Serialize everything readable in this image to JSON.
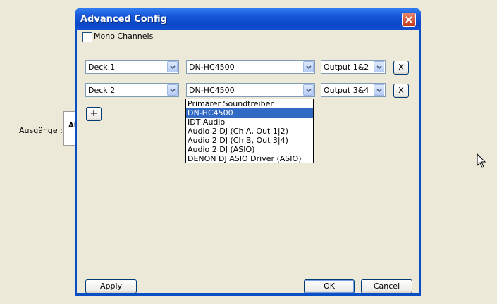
{
  "background": {
    "outputs_label": "Ausgänge :",
    "box_text": "AI"
  },
  "dialog": {
    "title": "Advanced Config",
    "mono_channels_label": "Mono Channels",
    "mono_channels_checked": false,
    "rows": [
      {
        "deck": "Deck 1",
        "device": "DN-HC4500",
        "output": "Output 1&2",
        "remove_label": "X"
      },
      {
        "deck": "Deck 2",
        "device": "DN-HC4500",
        "output": "Output 3&4",
        "remove_label": "X"
      }
    ],
    "add_label": "+",
    "device_dropdown": {
      "options": [
        "Primärer Soundtreiber",
        "DN-HC4500",
        "IDT Audio",
        "Audio 2 DJ (Ch A, Out 1|2)",
        "Audio 2 DJ (Ch B, Out 3|4)",
        "Audio 2 DJ (ASIO)",
        "DENON DJ ASIO Driver (ASIO)"
      ],
      "selected": "DN-HC4500"
    },
    "apply_label": "Apply",
    "ok_label": "OK",
    "cancel_label": "Cancel"
  },
  "colors": {
    "titlebar": "#0a4ec5",
    "selection": "#316ac5",
    "window_bg": "#ece9d8"
  }
}
